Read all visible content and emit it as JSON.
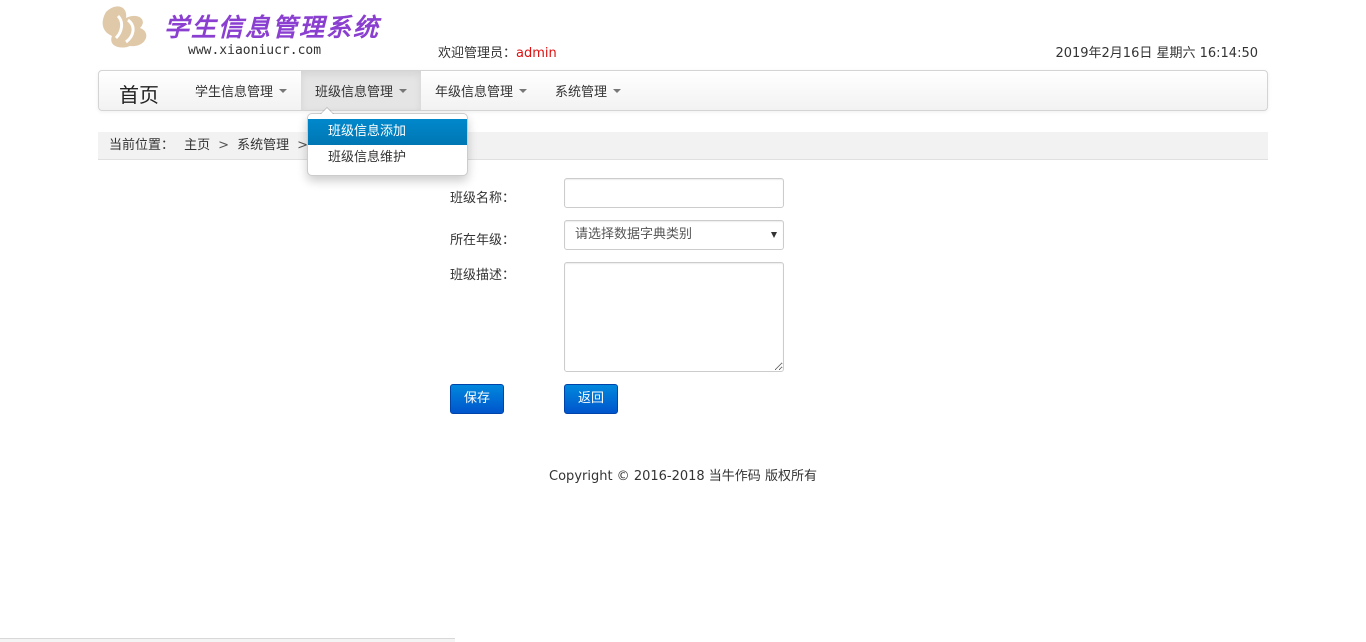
{
  "header": {
    "logo_title": "学生信息管理系统",
    "logo_url": "www.xiaoniucr.com",
    "welcome_prefix": "欢迎管理员：",
    "welcome_user": "admin",
    "datetime": "2019年2月16日 星期六 16:14:50",
    "colors": {
      "title": "#8a3fd0",
      "user": "#e01010",
      "logo_mark": "#d9c09a"
    }
  },
  "navbar": {
    "brand": "首页",
    "items": [
      {
        "label": "学生信息管理",
        "active": false
      },
      {
        "label": "班级信息管理",
        "active": true
      },
      {
        "label": "年级信息管理",
        "active": false
      },
      {
        "label": "系统管理",
        "active": false
      }
    ]
  },
  "dropdown": {
    "items": [
      {
        "label": "班级信息添加",
        "highlighted": true
      },
      {
        "label": "班级信息维护",
        "highlighted": false
      }
    ],
    "highlight_color": "#0081c2"
  },
  "breadcrumb": {
    "prefix": "当前位置：",
    "items": [
      "主页",
      "系统管理"
    ],
    "separator": ">"
  },
  "form": {
    "class_name_label": "班级名称：",
    "class_name_value": "",
    "grade_label": "所在年级：",
    "grade_selected": "请选择数据字典类别",
    "desc_label": "班级描述：",
    "desc_value": "",
    "save_label": "保存",
    "back_label": "返回",
    "button_color": "#0066cc"
  },
  "footer": {
    "copyright": "Copyright © 2016-2018 当牛作码 版权所有"
  }
}
